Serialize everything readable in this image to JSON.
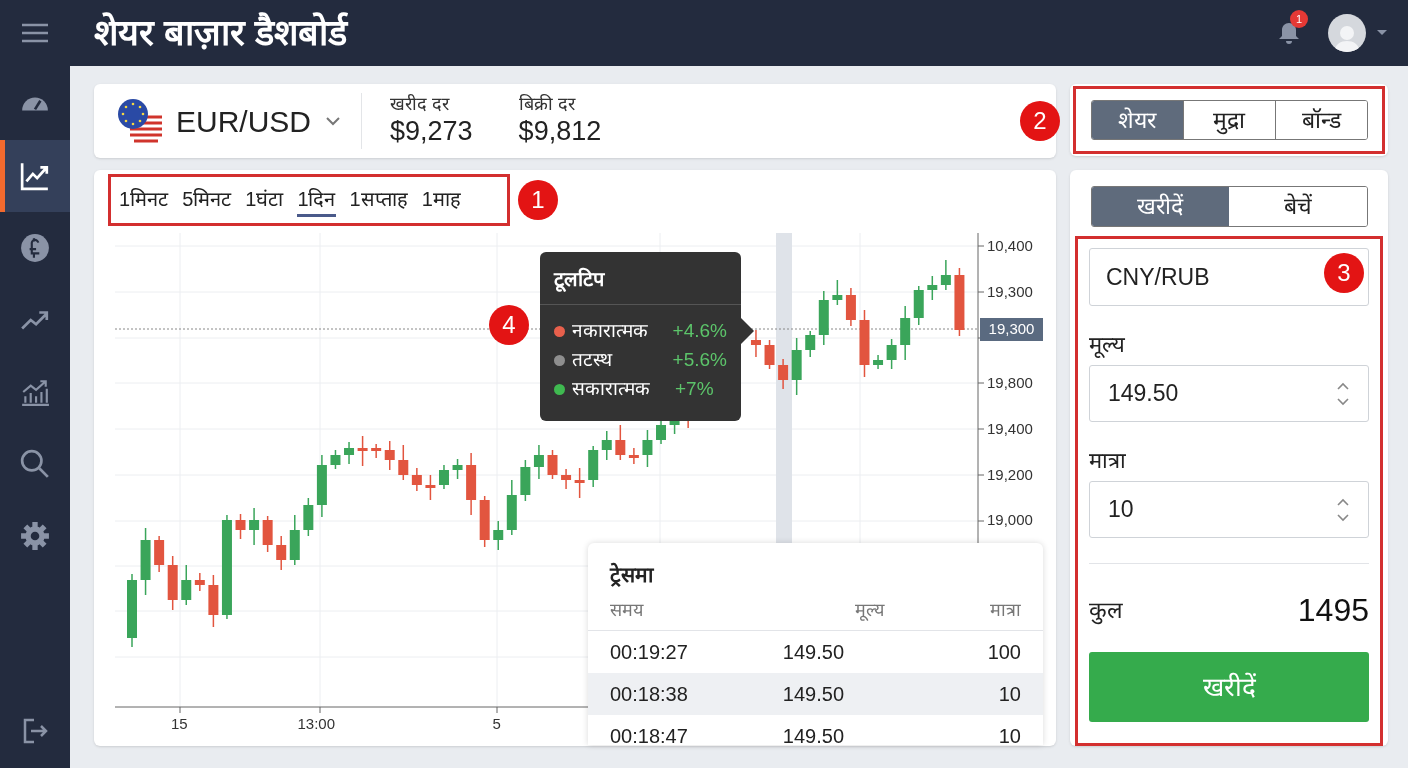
{
  "header": {
    "title": "शेयर बाज़ार डैशबोर्ड",
    "notification_count": "1"
  },
  "sidebar": {
    "items": [
      {
        "kind": "gauge",
        "selected": false
      },
      {
        "kind": "chart",
        "selected": true
      },
      {
        "kind": "coin",
        "selected": false
      },
      {
        "kind": "trend",
        "selected": false
      },
      {
        "kind": "bars",
        "selected": false
      },
      {
        "kind": "search",
        "selected": false
      },
      {
        "kind": "settings",
        "selected": false
      }
    ]
  },
  "instrument": {
    "pair": "EUR/USD",
    "buy_label": "खरीद दर",
    "buy_value": "$9,273",
    "sell_label": "बिक्री दर",
    "sell_value": "$9,812"
  },
  "market_tabs": [
    {
      "label": "शेयर",
      "selected": true
    },
    {
      "label": "मुद्रा",
      "selected": false
    },
    {
      "label": "बॉन्ड",
      "selected": false
    }
  ],
  "chart": {
    "timeframes": [
      {
        "label": "1मिनट",
        "selected": false
      },
      {
        "label": "5मिनट",
        "selected": false
      },
      {
        "label": "1घंटा",
        "selected": false
      },
      {
        "label": "1दिन",
        "selected": true
      },
      {
        "label": "1सप्ताह",
        "selected": false
      },
      {
        "label": "1माह",
        "selected": false
      }
    ],
    "y_labels": [
      "10,400",
      "19,300",
      "19,800",
      "19,400",
      "19,200",
      "19,000"
    ],
    "price_tag": "19,300",
    "x_labels": [
      "15",
      "13:00",
      "5"
    ],
    "tooltip": {
      "title": "टूलटिप",
      "rows": [
        {
          "label": "नकारात्मक",
          "value": "+4.6%",
          "color": "#e8604c"
        },
        {
          "label": "तटस्थ",
          "value": "+5.6%",
          "color": "#8e8e8e"
        },
        {
          "label": "सकारात्मक",
          "value": "+7%",
          "color": "#3fb950"
        }
      ]
    }
  },
  "trades": {
    "title": "ट्रेसमा",
    "columns": [
      "समय",
      "मूल्य",
      "मात्रा"
    ],
    "rows": [
      {
        "cells": [
          "00:19:27",
          "149.50",
          "100"
        ],
        "selected": false
      },
      {
        "cells": [
          "00:18:38",
          "149.50",
          "10"
        ],
        "selected": true
      },
      {
        "cells": [
          "00:18:47",
          "149.50",
          "10"
        ],
        "selected": false
      }
    ]
  },
  "order": {
    "sides": [
      {
        "label": "खरीदें",
        "selected": true
      },
      {
        "label": "बेचें",
        "selected": false
      }
    ],
    "pair": "CNY/RUB",
    "price_label": "मूल्य",
    "price": "149.50",
    "quantity_label": "मात्रा",
    "quantity": "10",
    "total_label": "कुल",
    "total": "1495",
    "submit": "खरीदें"
  },
  "callouts": [
    "1",
    "2",
    "3",
    "4"
  ]
}
